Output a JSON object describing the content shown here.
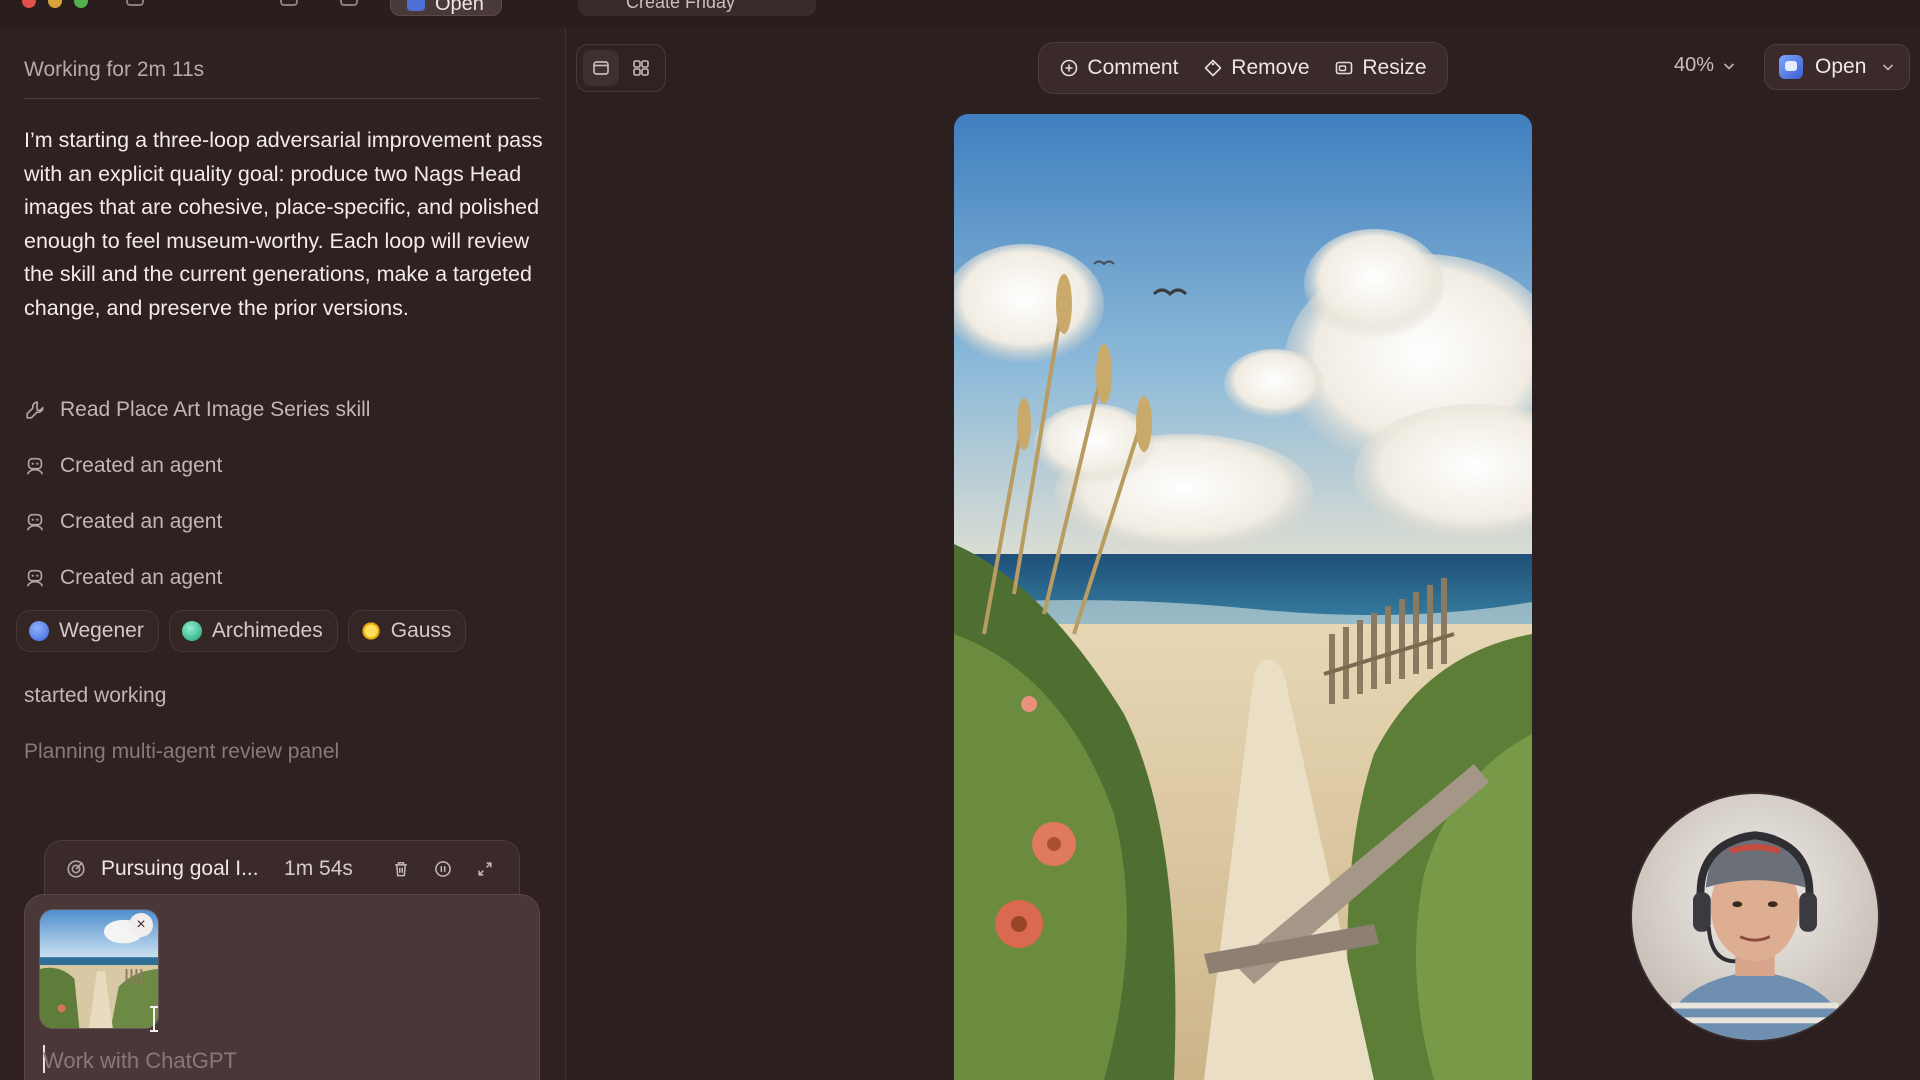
{
  "top": {
    "open_label": "Open",
    "tab_label": "Create Friday"
  },
  "left": {
    "status": "Working for 2m 11s",
    "message": "I’m starting a three-loop adversarial improvement pass with an explicit quality goal: produce two Nags Head images that are cohesive, place-specific, and polished enough to feel museum-worthy. Each loop will review the skill and the current generations, make a targeted change, and preserve the prior versions.",
    "steps": [
      {
        "icon": "wrench-icon",
        "label": "Read Place Art Image Series skill"
      },
      {
        "icon": "agent-icon",
        "label": "Created an agent"
      },
      {
        "icon": "agent-icon",
        "label": "Created an agent"
      },
      {
        "icon": "agent-icon",
        "label": "Created an agent"
      }
    ],
    "agents": [
      {
        "name": "Wegener",
        "color": "#4a72e0"
      },
      {
        "name": "Archimedes",
        "color": "#27b07f"
      },
      {
        "name": "Gauss",
        "color": "#f2c21b"
      }
    ],
    "started_text": "started working",
    "planning_text": "Planning multi-agent review panel",
    "goal": {
      "label": "Pursuing goal I...",
      "time": "1m 54s"
    },
    "composer": {
      "placeholder": "Work with ChatGPT",
      "attachment": "beach-path-thumbnail"
    }
  },
  "main": {
    "toolbar": {
      "comment_label": "Comment",
      "remove_label": "Remove",
      "resize_label": "Resize"
    },
    "zoom_label": "40%",
    "open_label": "Open"
  },
  "colors": {
    "background": "#2c1f1f",
    "panel": "#2f2121",
    "accent_blue": "#4a72e0"
  }
}
